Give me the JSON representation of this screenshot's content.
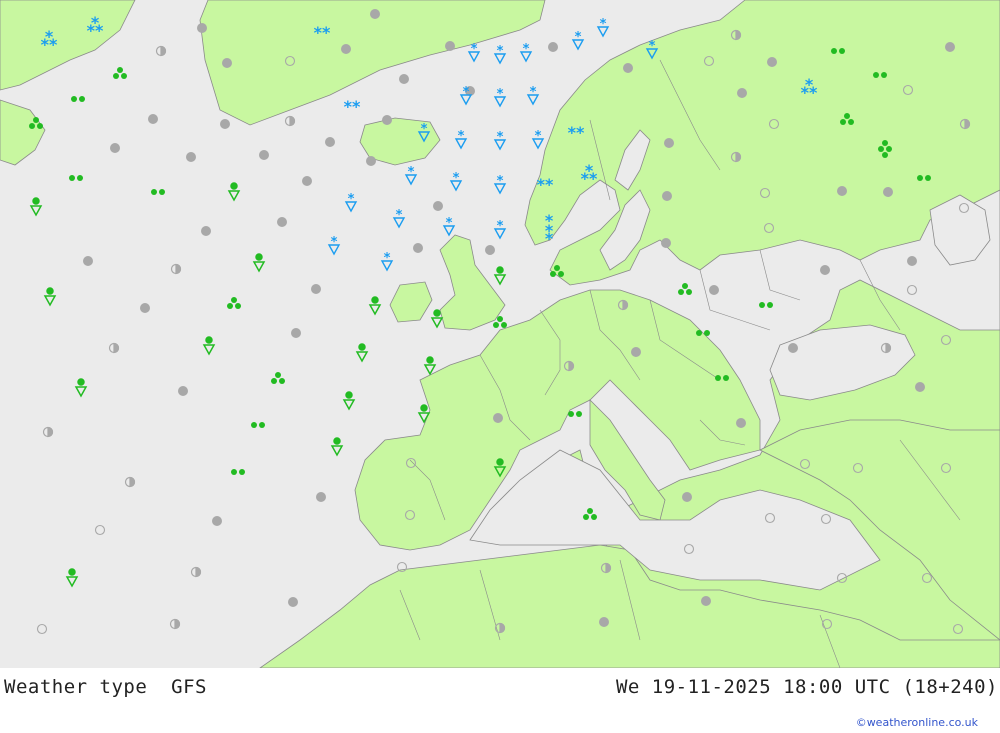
{
  "title": "Weather type",
  "model": "GFS",
  "valid_time": "We 19-11-2025 18:00 UTC (18+240)",
  "credit": "©weatheronline.co.uk",
  "colors": {
    "sea": "#ebebeb",
    "land": "#c8f7a0",
    "border": "#8a8a8a",
    "rain": "#22bb22",
    "snow": "#1b9df0",
    "dry": "#a8a8a8"
  },
  "legend_symbols": [
    "cloud-dot",
    "partly-cloudy",
    "clear",
    "drizzle",
    "showers",
    "rain",
    "heavy-rain",
    "snow",
    "snow-showers"
  ]
}
